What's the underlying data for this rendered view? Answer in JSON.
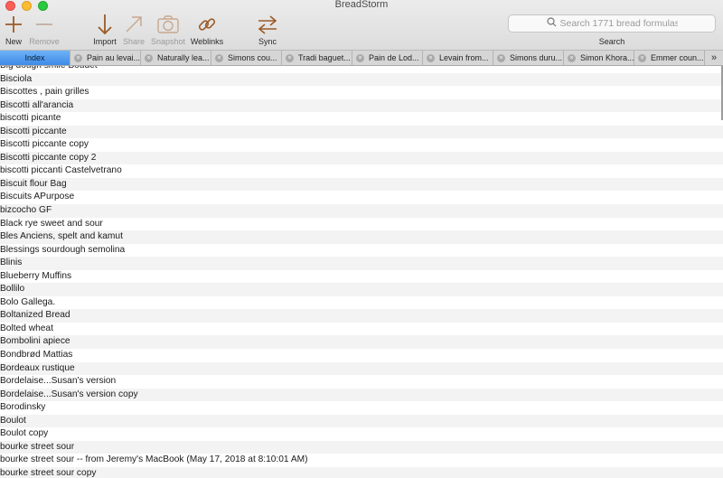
{
  "window": {
    "title": "BreadStorm"
  },
  "toolbar": {
    "new": "New",
    "remove": "Remove",
    "import": "Import",
    "share": "Share",
    "snapshot": "Snapshot",
    "weblinks": "Weblinks",
    "sync": "Sync",
    "icons": [
      "plus-icon",
      "minus-icon",
      "arrow-down-icon",
      "arrow-up-right-icon",
      "camera-icon",
      "link-icon",
      "sync-arrows-icon"
    ]
  },
  "search": {
    "placeholder": "Search 1771 bread formulas",
    "label": "Search"
  },
  "tabs": {
    "index": "Index",
    "items": [
      "Pain au levai...",
      "Naturally lea...",
      "Simons cou...",
      "Tradi baguet...",
      "Pain de Lod...",
      "Levain from...",
      "Simons duru...",
      "Simon Khora...",
      "Emmer coun..."
    ],
    "more": "»"
  },
  "list": [
    "Big dough smile Boudet",
    "Bisciola",
    "Biscottes , pain grilles",
    "Biscotti all'arancia",
    "biscotti picante",
    "Biscotti piccante",
    "Biscotti piccante copy",
    "Biscotti piccante copy 2",
    "biscotti piccanti Castelvetrano",
    "Biscuit flour Bag",
    "Biscuits APurpose",
    "bizcocho GF",
    "Black rye sweet and sour",
    "Bles Anciens, spelt and kamut",
    "Blessings sourdough semolina",
    "Blinis",
    "Blueberry Muffins",
    "Bollilo",
    "Bolo Gallega.",
    "Boltanized Bread",
    "Bolted wheat",
    "Bombolini apiece",
    "Bondbrød Mattias",
    "Bordeaux rustique",
    "Bordelaise...Susan's version",
    "Bordelaise...Susan's version copy",
    "Borodinsky",
    "Boulot",
    "Boulot copy",
    "bourke street sour",
    "bourke street sour -- from Jeremy's MacBook (May 17, 2018 at 8:10:01 AM)",
    "bourke street sour copy"
  ]
}
